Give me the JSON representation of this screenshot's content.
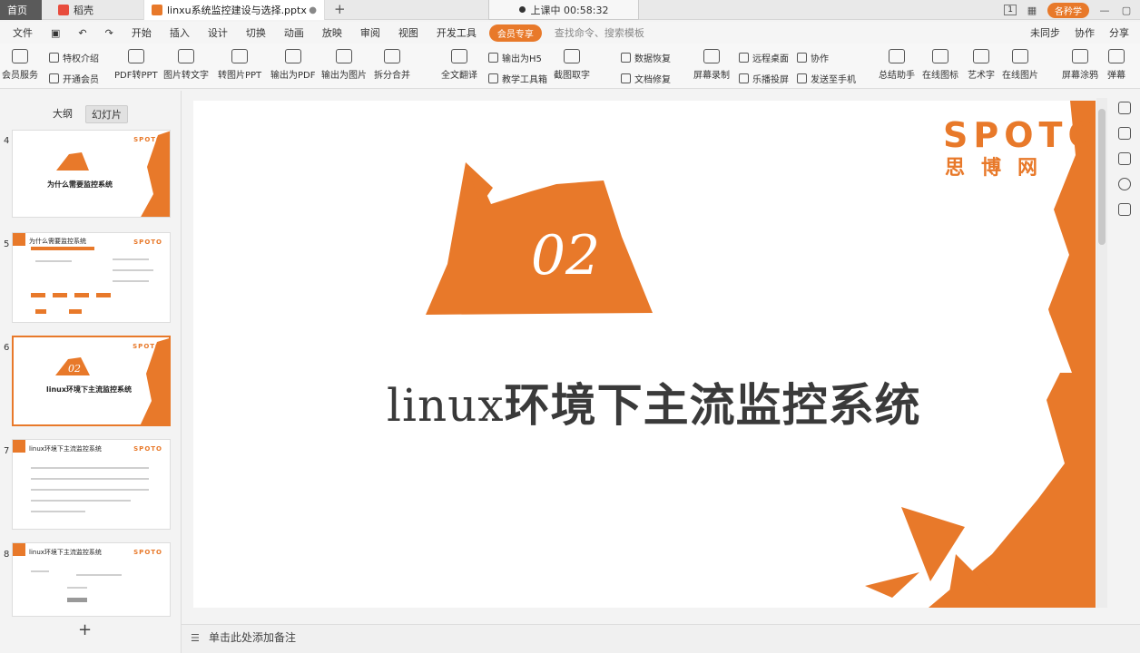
{
  "titlebar": {
    "home_tab": "首页",
    "daoke_tab": "稻壳",
    "doc_tab": "linxu系统监控建设与选择.pptx",
    "new_tab": "+",
    "recording": "上课中 00:58:32",
    "user": "各矜学",
    "page_indicator": "1"
  },
  "menubar": {
    "file": "文件",
    "items": [
      "开始",
      "插入",
      "设计",
      "切换",
      "动画",
      "放映",
      "审阅",
      "视图",
      "开发工具"
    ],
    "vip": "会员专享",
    "search": "查找命令、搜索模板",
    "right": [
      "未同步",
      "协作",
      "分享"
    ]
  },
  "ribbon": {
    "member_service": "会员服务",
    "privilege": "特权介绍",
    "open_member": "开通会员",
    "buttons": [
      "PDF转PPT",
      "图片转文字",
      "转图片PPT",
      "输出为PDF",
      "输出为图片",
      "拆分合并",
      "全文翻译",
      "截图取字",
      "屏幕录制",
      "总结助手",
      "在线图标",
      "艺术字",
      "在线图片",
      "屏幕涂鸦",
      "弹幕"
    ],
    "small": [
      "输出为H5",
      "教学工具箱",
      "数据恢复",
      "文档修复",
      "远程桌面",
      "乐播投屏",
      "协作",
      "发送至手机"
    ]
  },
  "leftpanel": {
    "tab_outline": "大纲",
    "tab_slides": "幻灯片",
    "thumbs": [
      {
        "num": "4",
        "title": "为什么需要监控系统",
        "badge": "01"
      },
      {
        "num": "5",
        "title": "为什么需要监控系统",
        "badge": ""
      },
      {
        "num": "6",
        "title": "linux环境下主流监控系统",
        "badge": "02"
      },
      {
        "num": "7",
        "title": "linux环境下主流监控系统",
        "badge": ""
      },
      {
        "num": "8",
        "title": "linux环境下主流监控系统",
        "badge": ""
      }
    ],
    "add": "+"
  },
  "slide": {
    "number": "02",
    "title_latin": "linux",
    "title_cn": "环境下主流监控系统",
    "logo_en": "SPOTO",
    "logo_cn": "思博网"
  },
  "notes": {
    "placeholder": "单击此处添加备注"
  },
  "colors": {
    "accent": "#e8792a",
    "title": "#3a3a3a"
  }
}
